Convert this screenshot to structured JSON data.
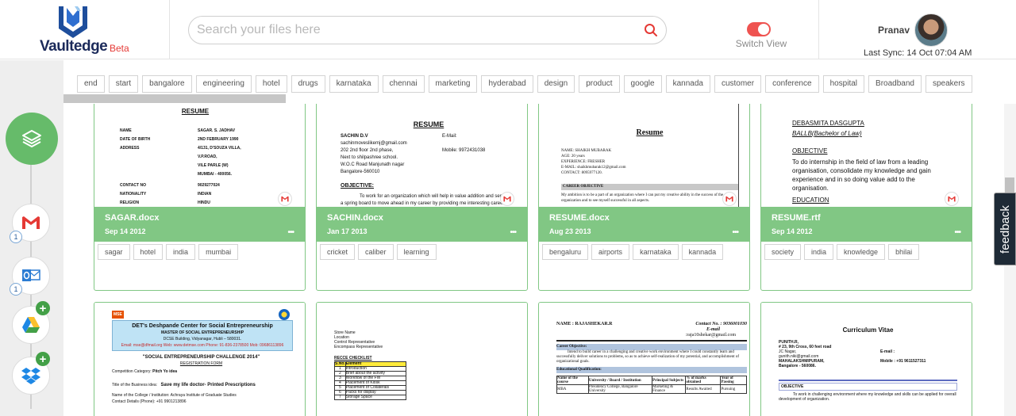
{
  "brand": {
    "name": "Vaultedge",
    "badge": "Beta"
  },
  "search": {
    "placeholder": "Search your files here"
  },
  "view_toggle": {
    "label": "Switch View",
    "on": true
  },
  "user": {
    "name": "Pranav",
    "last_sync": "Last Sync: 14 Oct 07:04 AM"
  },
  "sidebar": {
    "gmail_count": "1",
    "outlook_count": "1",
    "add_icon": "+"
  },
  "tags": [
    "end",
    "start",
    "bangalore",
    "engineering",
    "hotel",
    "drugs",
    "karnataka",
    "chennai",
    "marketing",
    "hyderabad",
    "design",
    "product",
    "google",
    "kannada",
    "customer",
    "conference",
    "hospital",
    "Broadband",
    "speakers"
  ],
  "cards": [
    {
      "file_name": "SAGAR.docx",
      "date": "Sep 14 2012",
      "more": "•••",
      "tags": [
        "sagar",
        "hotel",
        "india",
        "mumbai"
      ],
      "preview": {
        "title": "RESUME",
        "rows": [
          [
            "NAME",
            "SAGAR. S. JADHAV"
          ],
          [
            "DATE OF BIRTH",
            "2ND FEBRUARY 1990"
          ],
          [
            "ADDRESS",
            "4/131, D'SOUZA VILLA,"
          ],
          [
            "",
            "V.P.ROAD,"
          ],
          [
            "",
            "VILE PARLE (W)"
          ],
          [
            "",
            "MUMBAI - 400056."
          ],
          [
            "CONTACT NO",
            "9029277024"
          ],
          [
            "NATIONALITY",
            "INDIAN"
          ],
          [
            "RELIGION",
            "HINDU"
          ]
        ]
      }
    },
    {
      "file_name": "SACHIN.docx",
      "date": "Jan 17 2013",
      "more": "•••",
      "tags": [
        "cricket",
        "caliber",
        "learning"
      ],
      "preview": {
        "title": "RESUME",
        "name": "SACHIN D.V",
        "lines": [
          "sachinmoveslikemj@gmail.com",
          "202 2nd floor 2nd phase,",
          "Next to shilpashree school.",
          "W.O.C Road Manjunath nagar",
          "Bangalore-560010"
        ],
        "email_label": "E-Mail:",
        "mobile": "Mobile:   9972431038",
        "objective_title": "OBJECTIVE:",
        "objective": "To work for an organization which will help in value addition and serve as a spring board to move ahead in my career by providing me interesting career opportunities and harness the best of my caliber."
      }
    },
    {
      "file_name": "RESUME.docx",
      "date": "Aug 23 2013",
      "more": "•••",
      "tags": [
        "bengaluru",
        "airports",
        "karnataka",
        "kannada"
      ],
      "preview": {
        "title": "Resume",
        "lines": [
          "NAME: SHAIKH MUBARAK",
          "AGE: 20 years",
          "EXPERIENCE: FRESHER",
          "E-MAIL: shaikhmubarak12@gmail.com",
          "CONTACT: 8095977120."
        ],
        "section": "CAREER OBJECTIVE",
        "objective": "My ambition is to be a part of an organization where I can put my creative ability in the success of the organization and to see myself successful in all aspects."
      }
    },
    {
      "file_name": "RESUME.rtf",
      "date": "Sep 14 2012",
      "more": "•••",
      "tags": [
        "society",
        "india",
        "knowledge",
        "bhilai"
      ],
      "preview": {
        "name": "DEBASMITA DASGUPTA",
        "degree": "BALLB(Bachelor of Law)",
        "objective_title": "OBJECTIVE",
        "objective": "To do internship in the field of law from a leading organisation, consolidate my knowledge and gain experience and in so doing value add to the organisation.",
        "education_title": "EDUCATION"
      }
    },
    {
      "preview": {
        "logo": "MSE",
        "org": "DET's Deshpande Center for Social Entrepreneurship",
        "program": "MASTER OF SOCIAL ENTREPRENEURSHIP",
        "address": "DCSE Building, Vidyanagar, Hubli – 580031.",
        "contact": "Email: mse@dfmail.org Web: www.detmse.com Phone: 91-836-2378500 Mob: 09686113896",
        "challenge": "\"SOCIAL ENTREPRENEURSHIP CHALLENGE 2014\"",
        "form": "REGISTRATION FORM",
        "category_label": "Competition Category:",
        "category_value": "Pitch Yo  idea",
        "idea_label": "Title of the Business idea:",
        "idea_value": "Save my life doctor- Printed Prescriptions",
        "college": "Name of the College / Institution: Achraya Institute of Graduate Studies",
        "contact_details": "Contact Details (Phone): +91 9901213896"
      }
    },
    {
      "preview": {
        "lines": [
          "Store Name",
          "Location",
          "Control Representative",
          "Encompass Representative"
        ],
        "checklist_title": "RECCE CHECKLIST",
        "header": [
          "S.No.",
          "Element"
        ],
        "rows": [
          [
            "1",
            "Introduction"
          ],
          [
            "2",
            "Brief about the activity"
          ],
          [
            "3",
            "Workflow of the FW"
          ],
          [
            "4",
            "Placement of Kiosk"
          ],
          [
            "5",
            "Placement of Collaterals"
          ],
          [
            "6",
            "Packs for display"
          ],
          [
            "7",
            "Storage Space"
          ]
        ]
      }
    },
    {
      "preview": {
        "name": "NAME : RAJASHEKAR.R",
        "contact": "Contact No. : 9036001030",
        "email_label": "E-mail",
        "email": ":raja10shekar@gmail.com",
        "section1": "Career Objective:",
        "objective": "Intend to build career in a challenging and creative work environment where I could constantly learn and successfully deliver solutions to problems, so as to achieve self-realization of my potential, and accomplishment of organizational goals.",
        "section2": "Educational Qualification:",
        "table_header": [
          "Name of the course",
          "University / Board / Institution",
          "Principal Subjects",
          "% of marks obtained",
          "Year of Passing"
        ],
        "table_row": [
          "MBA",
          "Presidency College, Bangalore University",
          "Marketing & Finance",
          "Results Awaited",
          "Pursuing"
        ]
      }
    },
    {
      "preview": {
        "title": "Curriculum Vitae",
        "name": "PUNITH.R,",
        "addr": [
          "# 23, 9th Cross, 60 feet road",
          "JC Nagar,",
          "gunith.niki@gmail.com",
          "MAHALAKSHMIPURAM,",
          "Bangalore - 560086."
        ],
        "email_label": "E-mail :",
        "mobile": "Mobile   : +91 9611527311",
        "section": "OBJECTIVE",
        "objective": "To work in challenging environment where my knowledge and skills can be applied for overall development of organization."
      }
    }
  ],
  "feedback": {
    "label": "feedback"
  },
  "colors": {
    "accent_green": "#81c784",
    "brand_navy": "#1b2a5a",
    "toggle_red": "#ef5350"
  }
}
